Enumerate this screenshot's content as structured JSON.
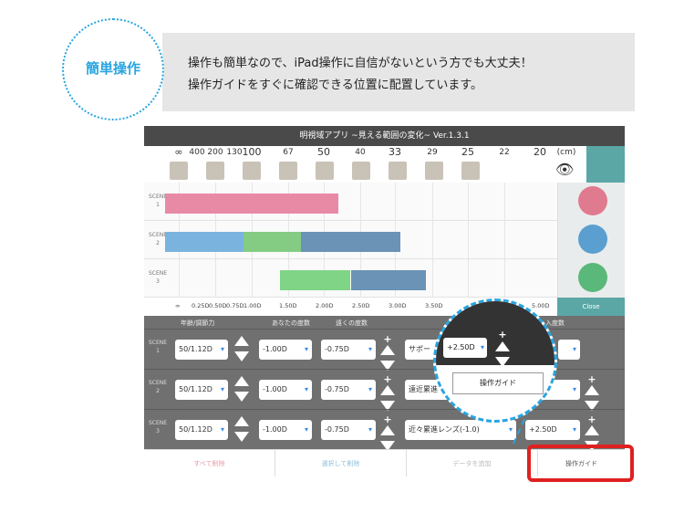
{
  "badge": {
    "label": "簡単操作"
  },
  "banner": {
    "line1": "操作も簡単なので、iPad操作に自信がないという方でも大丈夫！",
    "line2": "操作ガイドをすぐに確認できる位置に配置しています。"
  },
  "app": {
    "title": "明視域アプリ ~見える範囲の変化~ Ver.1.3.1",
    "distance_ticks": [
      "∞",
      "400",
      "200",
      "130",
      "100",
      "67",
      "50",
      "40",
      "33",
      "29",
      "25",
      "22",
      "20"
    ],
    "distance_unit": "(cm)",
    "scenes": [
      {
        "label_top": "SCENE",
        "label_num": "1",
        "bar": [
          {
            "color": "#e88aa6",
            "from": 0.05,
            "to": 0.47
          }
        ],
        "eye_color": "#e07a8e"
      },
      {
        "label_top": "SCENE",
        "label_num": "2",
        "bar": [
          {
            "color": "#7ab4de",
            "from": 0.05,
            "to": 0.24
          },
          {
            "color": "#84cc84",
            "from": 0.24,
            "to": 0.38
          },
          {
            "color": "#6a93b6",
            "from": 0.38,
            "to": 0.62
          }
        ],
        "eye_color": "#5a9fcf"
      },
      {
        "label_top": "SCENE",
        "label_num": "3",
        "bar": [
          {
            "color": "#7fd486",
            "from": 0.33,
            "to": 0.5
          },
          {
            "color": "#6a93b6",
            "from": 0.5,
            "to": 0.68
          }
        ],
        "eye_color": "#5ab87a"
      }
    ],
    "diopter_ticks": [
      "∞",
      "0.25D",
      "0.50D",
      "0.75D",
      "1.00D",
      "1.50D",
      "2.00D",
      "2.50D",
      "3.00D",
      "3.50D",
      "5.00D"
    ],
    "close_label": "Close",
    "headers": [
      "年齢/調節力",
      "あなたの度数",
      "遠くの度数",
      "入度数"
    ],
    "rows": [
      {
        "label_top": "SCENE",
        "label_num": "1",
        "age": "50/1.12D",
        "yours": "-1.00D",
        "far": "-0.75D",
        "lens": "サポー",
        "add": ""
      },
      {
        "label_top": "SCENE",
        "label_num": "2",
        "age": "50/1.12D",
        "yours": "-1.00D",
        "far": "-0.75D",
        "lens": "遠近累進",
        "add": "0D"
      },
      {
        "label_top": "SCENE",
        "label_num": "3",
        "age": "50/1.12D",
        "yours": "-1.00D",
        "far": "-0.75D",
        "lens": "近々累進レンズ(-1.0)",
        "add": "+2.50D"
      }
    ],
    "buttons": {
      "delete_all": "すべて削除",
      "delete_selected": "選択して削除",
      "add_data": "データを追加",
      "guide": "操作ガイド"
    }
  },
  "zoom": {
    "value": "+2.50D",
    "guide": "操作ガイド"
  },
  "colors": {
    "accent": "#2aa5e0",
    "highlight": "#e02020",
    "teal": "#5aa7a6"
  }
}
